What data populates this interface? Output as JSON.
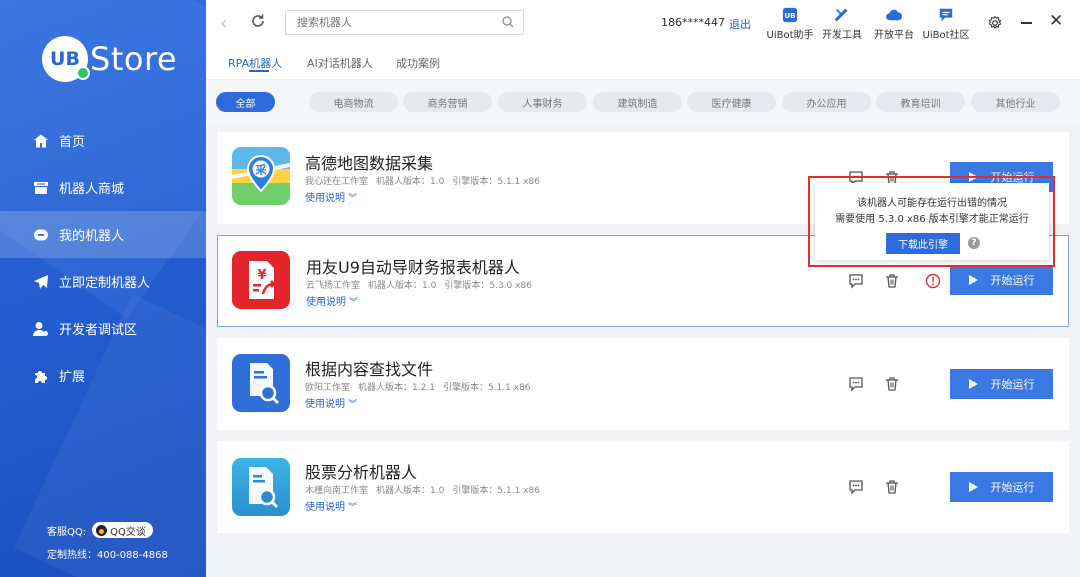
{
  "brand": {
    "badge": "UB",
    "name": "Store"
  },
  "sidebar": {
    "items": [
      {
        "label": "首页",
        "icon": "home-icon"
      },
      {
        "label": "机器人商城",
        "icon": "store-icon"
      },
      {
        "label": "我的机器人",
        "icon": "robot-icon",
        "active": true
      },
      {
        "label": "立即定制机器人",
        "icon": "send-icon"
      },
      {
        "label": "开发者调试区",
        "icon": "developer-icon"
      },
      {
        "label": "扩展",
        "icon": "puzzle-icon"
      }
    ],
    "support": {
      "qq_label": "客服QQ:",
      "qq_button": "QQ交谈",
      "hotline": "定制热线：400-088-4868"
    }
  },
  "topbar": {
    "search_placeholder": "搜索机器人",
    "phone": "186****447",
    "logout": "退出",
    "tools": [
      {
        "label": "UiBot助手",
        "icon": "uibot-assistant-icon"
      },
      {
        "label": "开发工具",
        "icon": "dev-tool-icon"
      },
      {
        "label": "开放平台",
        "icon": "cloud-icon"
      },
      {
        "label": "UiBot社区",
        "icon": "chat-icon"
      }
    ]
  },
  "tabs": [
    {
      "label": "RPA机器人",
      "active": true
    },
    {
      "label": "AI对话机器人"
    },
    {
      "label": "成功案例"
    }
  ],
  "categories": [
    "全部",
    "电商物流",
    "商务营销",
    "人事财务",
    "建筑制造",
    "医疗健康",
    "办公应用",
    "教育培训",
    "其他行业"
  ],
  "robots": [
    {
      "title": "高德地图数据采集",
      "studio": "我心还在工作室",
      "version_label": "机器人版本：",
      "version": "1.0",
      "engine_label": "引擎版本：",
      "engine": "5.1.1 x86",
      "doc": "使用说明",
      "run": "开始运行",
      "icon_char": "采"
    },
    {
      "title": "用友U9自动导财务报表机器人",
      "studio": "云飞扬工作室",
      "version_label": "机器人版本：",
      "version": "1.0",
      "engine_label": "引擎版本：",
      "engine": "5.3.0 x86",
      "doc": "使用说明",
      "run": "开始运行",
      "icon_char": "¥"
    },
    {
      "title": "根据内容查找文件",
      "studio": "欧阳工作室",
      "version_label": "机器人版本：",
      "version": "1.2.1",
      "engine_label": "引擎版本：",
      "engine": "5.1.1 x86",
      "doc": "使用说明",
      "run": "开始运行"
    },
    {
      "title": "股票分析机器人",
      "studio": "木槿向南工作室",
      "version_label": "机器人版本：",
      "version": "1.0",
      "engine_label": "引擎版本：",
      "engine": "5.1.1 x86",
      "doc": "使用说明",
      "run": "开始运行"
    }
  ],
  "popup": {
    "line1": "该机器人可能存在运行出错的情况",
    "line2": "需要使用 5.3.0 x86 版本引擎才能正常运行",
    "button": "下载此引擎",
    "help": "?"
  },
  "colors": {
    "primary": "#2d6bdc",
    "sidebar": "#245ed1",
    "warning": "#e52b2b",
    "success": "#2fc26b"
  }
}
